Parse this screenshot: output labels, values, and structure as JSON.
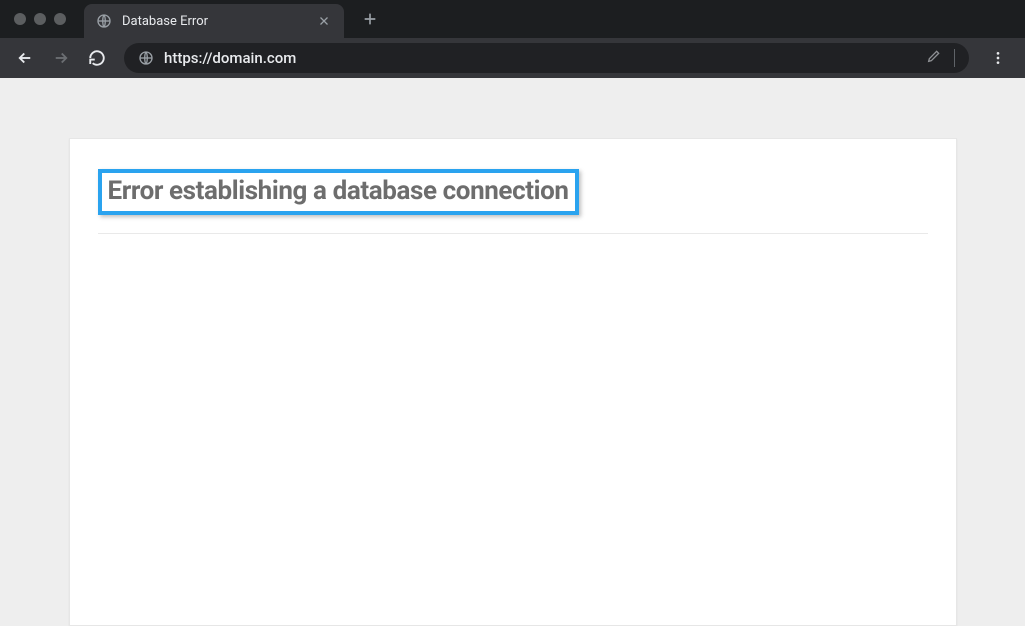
{
  "browser": {
    "tab_title": "Database Error",
    "url": "https://domain.com"
  },
  "page": {
    "error_heading": "Error establishing a database connection"
  }
}
